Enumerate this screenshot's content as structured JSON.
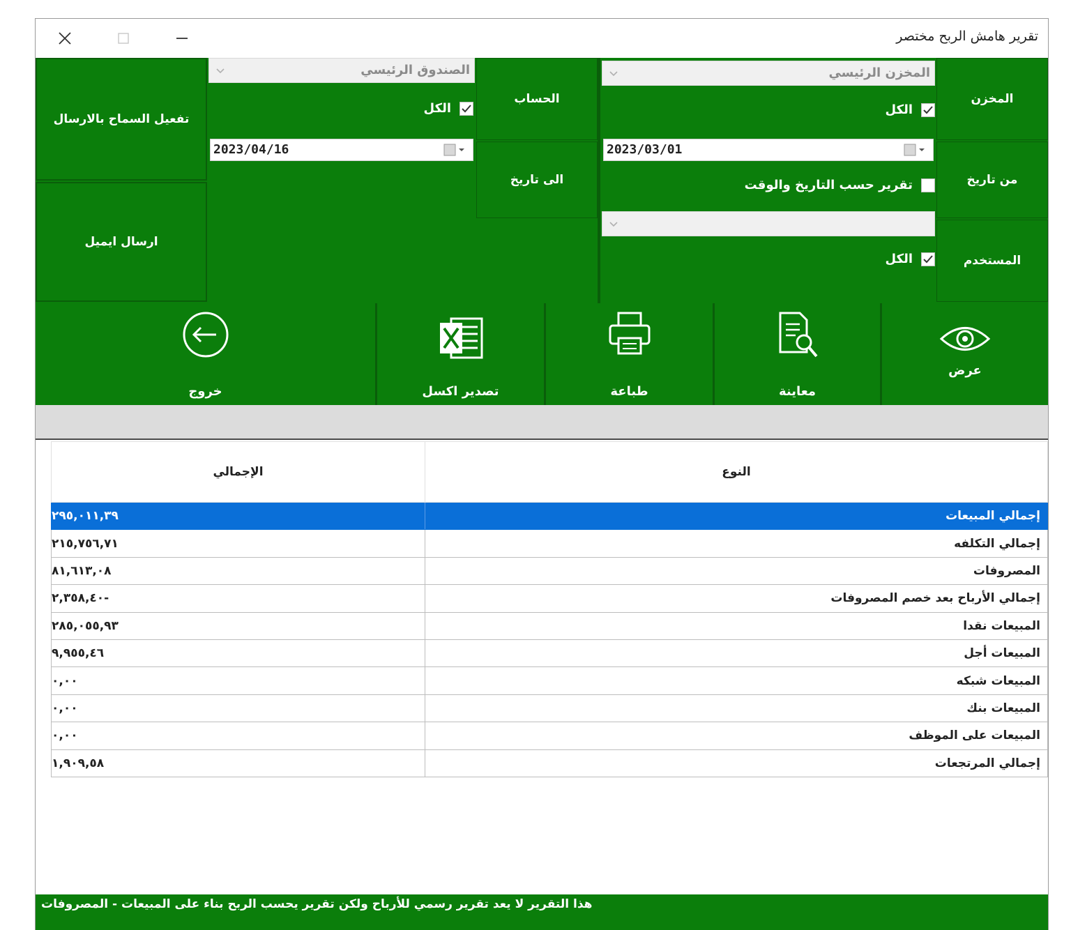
{
  "window": {
    "title": "تقرير هامش الربح مختصر"
  },
  "filters": {
    "store_label": "المخزن",
    "store_value": "المخزن الرئيسي",
    "store_all_label": "الكل",
    "store_all_checked": true,
    "account_label": "الحساب",
    "account_value": "الصندوق الرئيسي",
    "account_all_label": "الكل",
    "account_all_checked": true,
    "from_date_label": "من تاريخ",
    "from_date": "2023/03/01",
    "to_date_label": "الى تاريخ",
    "to_date": "2023/04/16",
    "datetime_report_label": "تقرير حسب التاريخ والوقت",
    "datetime_report_checked": false,
    "user_label": "المستخدم",
    "user_value": "",
    "user_all_label": "الكل",
    "user_all_checked": true,
    "enable_send_label": "تفعيل السماح بالارسال",
    "send_email_label": "ارسال ايميل"
  },
  "toolbar": {
    "view_label": "عرض",
    "preview_label": "معاينة",
    "print_label": "طباعة",
    "export_excel_label": "تصدير اكسل",
    "exit_label": "خروج"
  },
  "grid": {
    "columns": {
      "type": "النوع",
      "total": "الإجمالي"
    },
    "selected_row": 0,
    "rows": [
      {
        "type": "إجمالي المبيعات",
        "total": "٢٩٥,٠١١,٣٩"
      },
      {
        "type": "إجمالي التكلفه",
        "total": "٢١٥,٧٥٦,٧١"
      },
      {
        "type": "المصروفات",
        "total": "٨١,٦١٣,٠٨"
      },
      {
        "type": "إجمالي الأرباح بعد خصم المصروفات",
        "total": "-٢,٣٥٨,٤٠"
      },
      {
        "type": "المبيعات نقدا",
        "total": "٢٨٥,٠٥٥,٩٣"
      },
      {
        "type": "المبيعات أجل",
        "total": "٩,٩٥٥,٤٦"
      },
      {
        "type": "المبيعات شبكه",
        "total": "٠,٠٠"
      },
      {
        "type": "المبيعات بنك",
        "total": "٠,٠٠"
      },
      {
        "type": "المبيعات على الموظف",
        "total": "٠,٠٠"
      },
      {
        "type": "إجمالي المرتجعات",
        "total": "١,٩٠٩,٥٨"
      }
    ]
  },
  "footer": {
    "note": "هذا التقرير لا يعد تقرير رسمي للأرباح ولكن تقرير يحسب الربح بناء على المبيعات - المصروفات"
  },
  "colors": {
    "green": "#0b7e0b",
    "selection": "#0a6fd8"
  },
  "icons": {
    "close": "close-icon",
    "maximize": "maximize-icon",
    "minimize": "minimize-icon",
    "view": "eye-icon",
    "preview": "document-search-icon",
    "print": "printer-icon",
    "export": "excel-icon",
    "exit": "exit-arrow-icon"
  }
}
